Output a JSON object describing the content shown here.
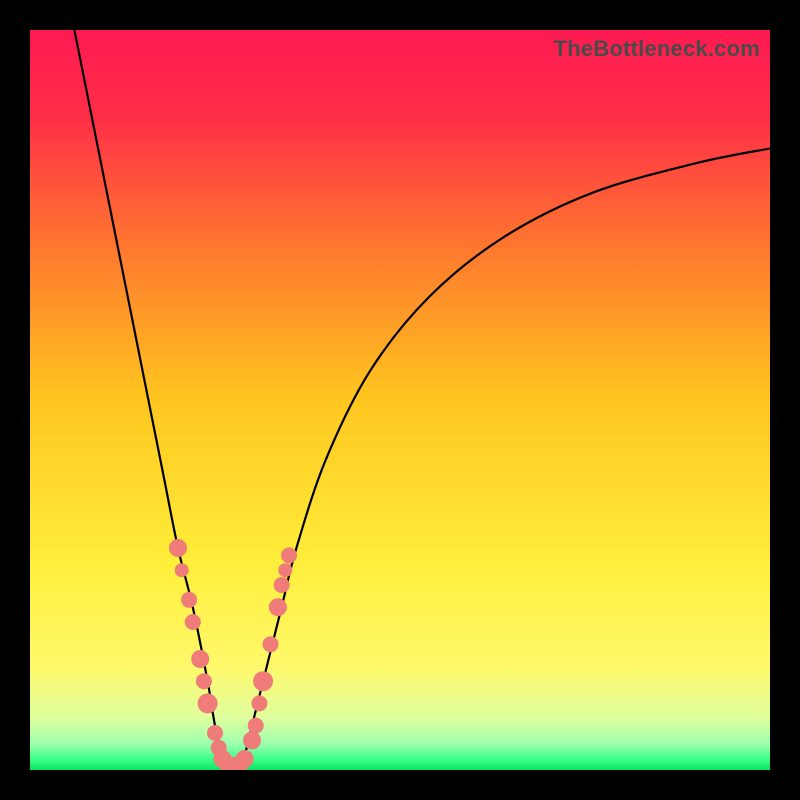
{
  "watermark": "TheBottleneck.com",
  "colors": {
    "frame": "#000000",
    "gradient_stops": [
      {
        "offset": 0.0,
        "color": "#ff1a52"
      },
      {
        "offset": 0.12,
        "color": "#ff2f47"
      },
      {
        "offset": 0.3,
        "color": "#ff7a2e"
      },
      {
        "offset": 0.5,
        "color": "#ffc61f"
      },
      {
        "offset": 0.72,
        "color": "#ffee3a"
      },
      {
        "offset": 0.86,
        "color": "#fff96b"
      },
      {
        "offset": 0.93,
        "color": "#dfff9e"
      },
      {
        "offset": 0.965,
        "color": "#9cffad"
      },
      {
        "offset": 0.985,
        "color": "#3eff8a"
      },
      {
        "offset": 1.0,
        "color": "#08e462"
      }
    ],
    "curve": "#000000",
    "marker": "#ef7c78"
  },
  "chart_data": {
    "type": "line",
    "title": "",
    "xlabel": "",
    "ylabel": "",
    "xlim": [
      0,
      100
    ],
    "ylim": [
      0,
      100
    ],
    "series": [
      {
        "name": "bottleneck-curve",
        "x": [
          6,
          8,
          10,
          12,
          14,
          16,
          18,
          20,
          22,
          24,
          25,
          26,
          27,
          28,
          29,
          30,
          32,
          34,
          36,
          40,
          46,
          54,
          64,
          76,
          90,
          100
        ],
        "y": [
          100,
          90,
          80,
          70,
          60,
          50,
          40,
          30,
          22,
          12,
          6,
          2,
          0,
          0,
          2,
          6,
          14,
          22,
          30,
          42,
          54,
          64,
          72,
          78,
          82,
          84
        ]
      }
    ],
    "markers": {
      "name": "highlight-points",
      "x": [
        20.0,
        20.5,
        21.5,
        22.0,
        23.0,
        23.5,
        24.0,
        25.0,
        25.5,
        26.0,
        27.0,
        28.0,
        29.0,
        30.0,
        30.5,
        31.0,
        31.5,
        32.5,
        33.5,
        34.0,
        34.5,
        35.0
      ],
      "y": [
        30.0,
        27.0,
        23.0,
        20.0,
        15.0,
        12.0,
        9.0,
        5.0,
        3.0,
        1.5,
        0.5,
        0.5,
        1.5,
        4.0,
        6.0,
        9.0,
        12.0,
        17.0,
        22.0,
        25.0,
        27.0,
        29.0
      ],
      "r": [
        9,
        7,
        8,
        8,
        9,
        8,
        10,
        8,
        8,
        9,
        10,
        10,
        9,
        9,
        8,
        8,
        10,
        8,
        9,
        8,
        7,
        8
      ]
    }
  }
}
